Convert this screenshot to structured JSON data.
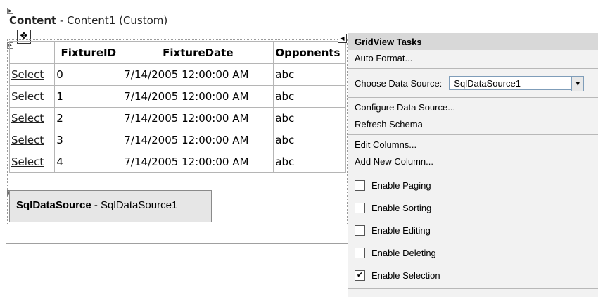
{
  "content": {
    "title_bold": "Content",
    "title_rest": " - Content1 (Custom)"
  },
  "grid": {
    "headers": [
      "",
      "FixtureID",
      "FixtureDate",
      "Opponents"
    ],
    "rows": [
      {
        "select": "Select",
        "id": "0",
        "date": "7/14/2005 12:00:00 AM",
        "opp": "abc"
      },
      {
        "select": "Select",
        "id": "1",
        "date": "7/14/2005 12:00:00 AM",
        "opp": "abc"
      },
      {
        "select": "Select",
        "id": "2",
        "date": "7/14/2005 12:00:00 AM",
        "opp": "abc"
      },
      {
        "select": "Select",
        "id": "3",
        "date": "7/14/2005 12:00:00 AM",
        "opp": "abc"
      },
      {
        "select": "Select",
        "id": "4",
        "date": "7/14/2005 12:00:00 AM",
        "opp": "abc"
      }
    ]
  },
  "sqldatasource": {
    "label_bold": "SqlDataSource",
    "label_rest": " - SqlDataSource1"
  },
  "tasks": {
    "header": "GridView Tasks",
    "auto_format": "Auto Format...",
    "choose_ds_label": "Choose Data Source:",
    "choose_ds_value": "SqlDataSource1",
    "configure_ds": "Configure Data Source...",
    "refresh_schema": "Refresh Schema",
    "edit_columns": "Edit Columns...",
    "add_column": "Add New Column...",
    "options": [
      {
        "label": "Enable Paging",
        "checked": false
      },
      {
        "label": "Enable Sorting",
        "checked": false
      },
      {
        "label": "Enable Editing",
        "checked": false
      },
      {
        "label": "Enable Deleting",
        "checked": false
      },
      {
        "label": "Enable Selection",
        "checked": true
      }
    ]
  }
}
